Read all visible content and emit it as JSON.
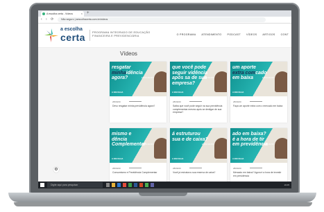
{
  "browser": {
    "tab_title": "A escolha certa - Vídeos",
    "new_tab": "+",
    "tab_close": "×",
    "nav": "‹ › ⟳",
    "url": "Não seguro | aescolhacerta.com.br/videos"
  },
  "site": {
    "logo_top": "a escolha",
    "logo_big": "certa",
    "tagline": "PROGRAMA INTEGRADO DE EDUCAÇÃO FINANCEIRA E PREVIDENCIÁRIA",
    "nav_items": [
      "O PROGRAMA",
      "ATENDIMENTO",
      "PODCAST",
      "VÍDEOS",
      "ARTIGOS",
      "CONT"
    ]
  },
  "page": {
    "title": "Vídeos"
  },
  "cards": [
    {
      "thumb_a": "resgatar ",
      "thumb_b": "minha",
      "thumb_c": "idência agora?",
      "small": "ESPECIALISTAS",
      "logo": "A ESCOLHA",
      "date": "28/09/20",
      "text": "Devo resgatar minha previdência agora?"
    },
    {
      "thumb_a": "que você pode seguir ",
      "thumb_b": "",
      "thumb_c": "vidência após sa de sua empresa?",
      "small": "ESPECIALISTAS",
      "logo": "A ESCOLHA",
      "date": "28/09/20",
      "text": "Saiba que você pode seguir na sua previdência complementar mesmo após se desligar de sua empresa?"
    },
    {
      "thumb_a": "um aporte ",
      "thumb_b": "extra com",
      "thumb_c": "cado em baixa",
      "small": "ESPECIALISTAS",
      "logo": "A ESCOLHA",
      "date": "28/09/20",
      "text": "Faça um aporte extra com o mercado em baixa"
    },
    {
      "thumb_a": "mismo e ",
      "thumb_b": "",
      "thumb_c": "dência Complementar",
      "small": "ESPECIALISTAS",
      "logo": "A ESCOLHA",
      "date": "28/09/20",
      "text": "Consumismo e Previdência Complementar"
    },
    {
      "thumb_a": "á estruturou sua ",
      "thumb_b": "",
      "thumb_c": "e de caixa?",
      "small": "ESPECIALISTAS",
      "logo": "A ESCOLHA",
      "date": "28/09/20",
      "text": "Você já estruturou sua reserva de caixa?"
    },
    {
      "thumb_a": "ado em baixa? ",
      "thumb_b": "",
      "thumb_c": "é a hora de tir em previdência",
      "small": "ESPECIALISTAS",
      "logo": "A ESCOLHA",
      "date": "28/09/20",
      "text": "Mercado em baixa? Agora é a hora de investir em previdência"
    }
  ],
  "taskbar": {
    "search_placeholder": "Digite aqui para pesquisar",
    "tray": "16:05"
  },
  "colors": {
    "teal": "#1a9c9a",
    "navy": "#1b2d52"
  },
  "icons": {
    "settings": "⚙"
  }
}
